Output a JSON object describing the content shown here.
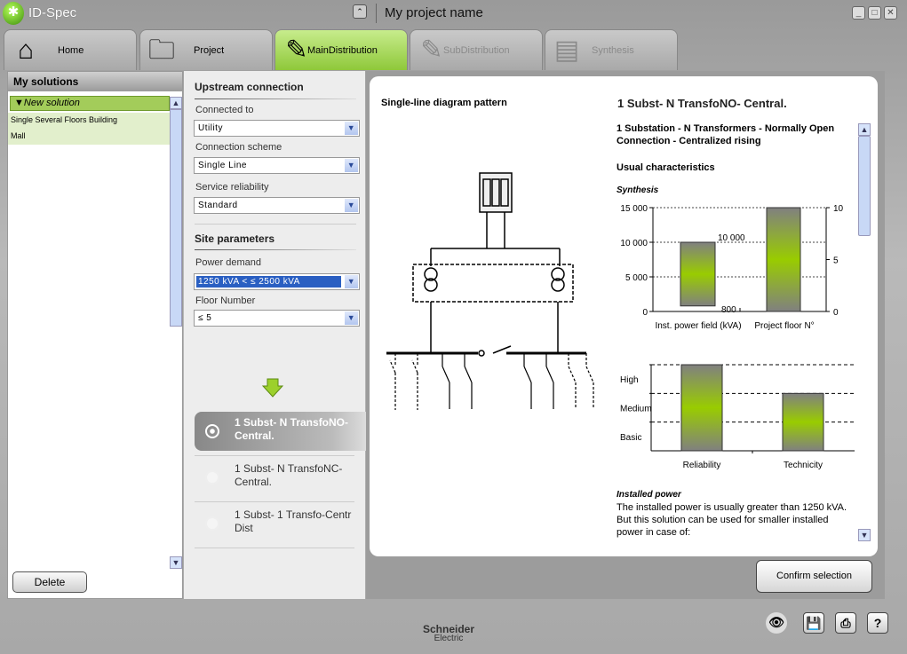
{
  "app": {
    "title": "ID-Spec",
    "project_name": "My project name"
  },
  "tabs": [
    {
      "label": "Home",
      "icon": "home-icon",
      "state": "normal"
    },
    {
      "label": "Project",
      "icon": "folder-icon",
      "state": "normal"
    },
    {
      "label": "MainDistribution",
      "icon": "pencil-icon",
      "state": "active"
    },
    {
      "label": "SubDistribution",
      "icon": "pencil-icon",
      "state": "disabled"
    },
    {
      "label": "Synthesis",
      "icon": "notebook-icon",
      "state": "disabled"
    }
  ],
  "solutions": {
    "title": "My solutions",
    "group": "▼New solution",
    "items": [
      "Single Several Floors Building",
      "Mall"
    ],
    "delete_label": "Delete"
  },
  "upstream": {
    "title": "Upstream connection",
    "fields": [
      {
        "label": "Connected to",
        "value": "Utility"
      },
      {
        "label": "Connection scheme",
        "value": "Single Line"
      },
      {
        "label": "Service reliability",
        "value": "Standard"
      }
    ]
  },
  "site": {
    "title": "Site parameters",
    "fields": [
      {
        "label": "Power demand",
        "value": "1250 kVA <  ≤ 2500 kVA"
      },
      {
        "label": "Floor Number",
        "value": "≤ 5"
      }
    ]
  },
  "options": [
    {
      "label": "1 Subst- N TransfoNO-Central.",
      "selected": true
    },
    {
      "label": "1 Subst- N TransfoNC-Central.",
      "selected": false
    },
    {
      "label": "1 Subst- 1 Transfo-Centr Dist",
      "selected": false
    }
  ],
  "detail": {
    "diagram_title": "Single-line diagram pattern",
    "title": "1 Subst- N TransfoNO- Central.",
    "subtitle": "1 Substation - N Transformers - Normally Open Connection - Centralized rising",
    "usual": "Usual characteristics",
    "synthesis": "Synthesis",
    "installed_title": "Installed power",
    "installed_text": "The installed power is usually greater than 1250 kVA. But this solution can be used for smaller installed power in case of:",
    "confirm_label": "Confirm selection"
  },
  "chart_data": [
    {
      "type": "bar",
      "left_ylim": [
        0,
        15000
      ],
      "right_ylim": [
        0,
        10
      ],
      "left_ticks": [
        "0",
        "5 000",
        "10 000",
        "15 000"
      ],
      "right_ticks": [
        "0",
        "5",
        "10"
      ],
      "categories": [
        "Inst. power field (kVA)",
        "Project floor N°"
      ],
      "bars": [
        {
          "category": "Inst. power field (kVA)",
          "axis": "left",
          "from": 800,
          "to": 10000,
          "labels": [
            "800",
            "10 000"
          ]
        },
        {
          "category": "Project floor N°",
          "axis": "right",
          "from": 0,
          "to": 10
        }
      ],
      "grid": true
    },
    {
      "type": "bar",
      "levels": [
        "Basic",
        "Medium",
        "High"
      ],
      "categories": [
        "Reliability",
        "Technicity"
      ],
      "values": [
        3,
        2
      ],
      "grid": true
    }
  ],
  "brand": {
    "name": "Schneider",
    "sub": "Electric"
  },
  "colors": {
    "accent": "#8fc83a",
    "bar_green": "#99cc00",
    "bar_grey": "#808080",
    "selection": "#2a5fc2"
  }
}
